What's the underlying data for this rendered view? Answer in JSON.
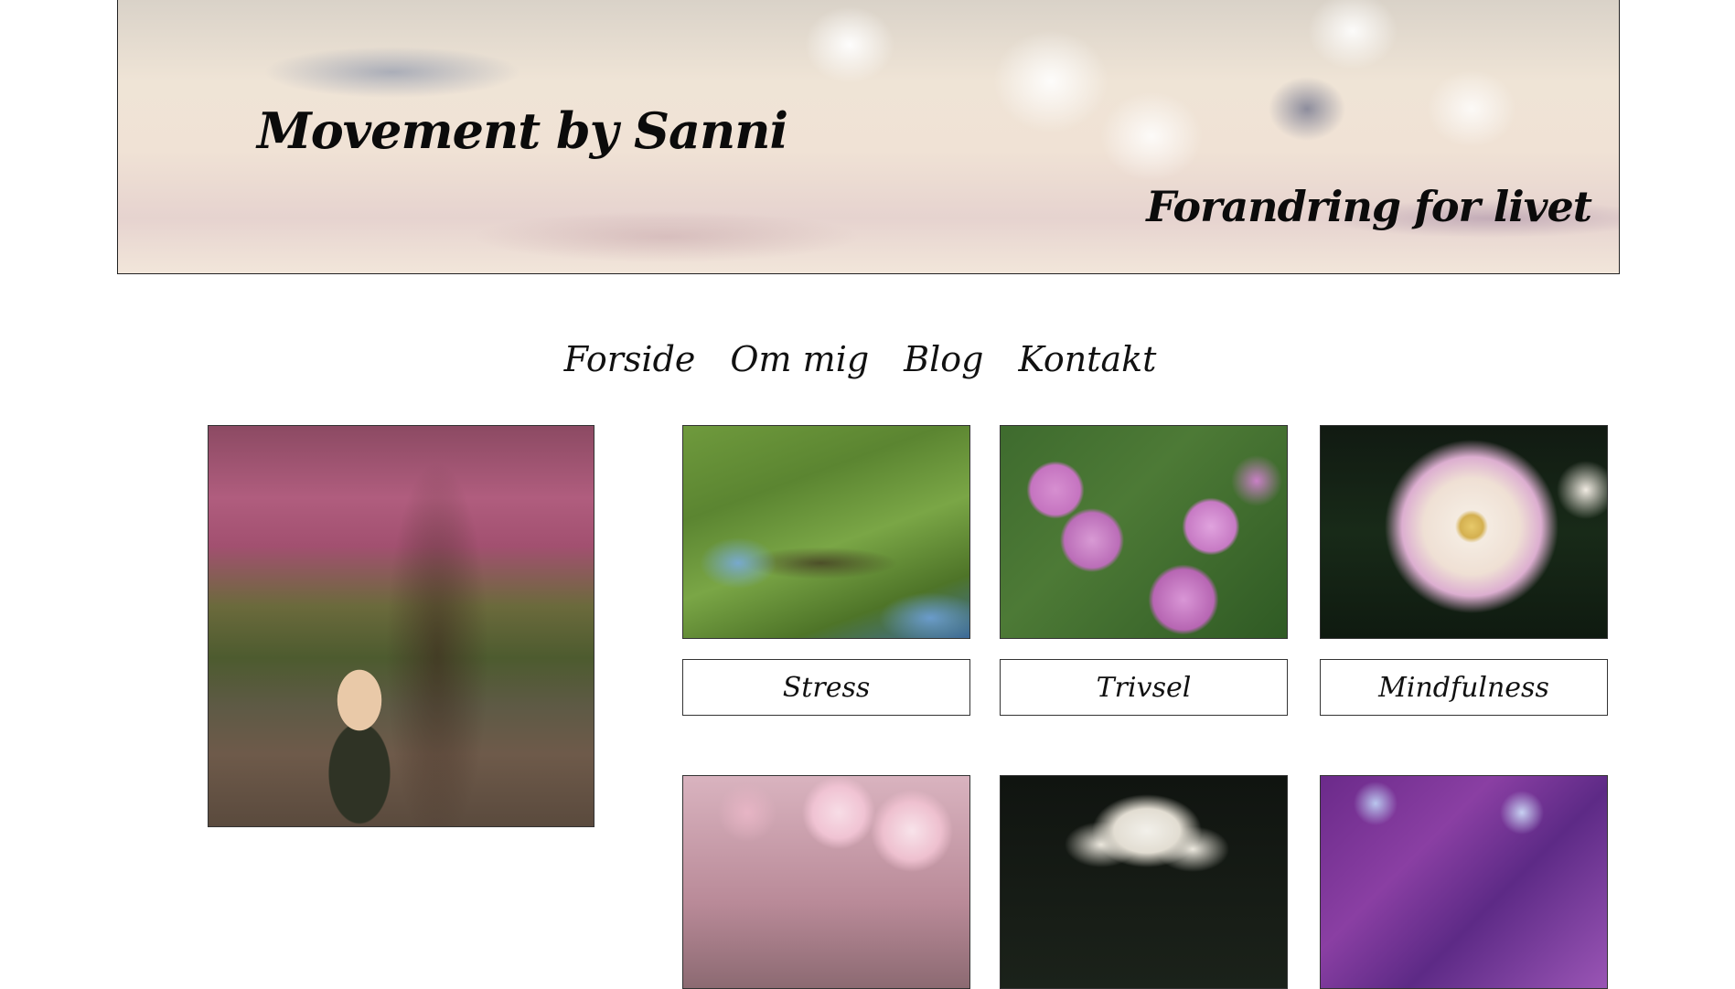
{
  "header": {
    "site_title": "Movement by Sanni",
    "tagline": "Forandring for livet"
  },
  "nav": {
    "items": [
      {
        "label": "Forside"
      },
      {
        "label": "Om mig"
      },
      {
        "label": "Blog"
      },
      {
        "label": "Kontakt"
      }
    ]
  },
  "categories": [
    {
      "label": "Stress"
    },
    {
      "label": "Trivsel"
    },
    {
      "label": "Mindfulness"
    }
  ],
  "colors": {
    "text": "#111111",
    "border": "#333333",
    "background": "#ffffff"
  }
}
